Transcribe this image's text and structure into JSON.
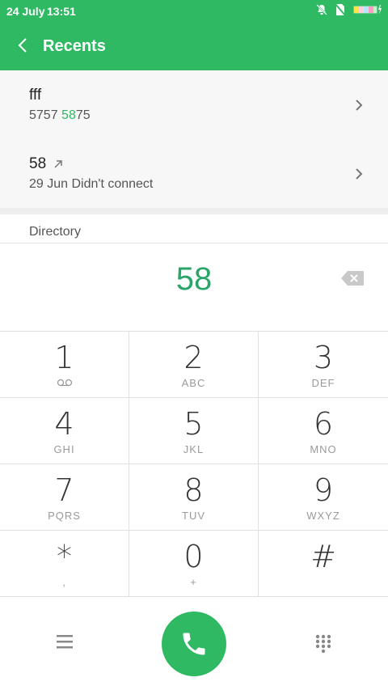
{
  "status_bar": {
    "date": "24 July",
    "time": "13:51"
  },
  "app_bar": {
    "title": "Recents"
  },
  "recents": [
    {
      "name": "fff",
      "number_prefix": "5757 ",
      "number_match": "58",
      "number_suffix": "75"
    },
    {
      "name": "58",
      "detail": "29 Jun Didn't connect"
    }
  ],
  "directory": {
    "label": "Directory"
  },
  "dialer": {
    "entered_number": "58"
  },
  "keypad": [
    {
      "digit": "1",
      "letters": ""
    },
    {
      "digit": "2",
      "letters": "ABC"
    },
    {
      "digit": "3",
      "letters": "DEF"
    },
    {
      "digit": "4",
      "letters": "GHI"
    },
    {
      "digit": "5",
      "letters": "JKL"
    },
    {
      "digit": "6",
      "letters": "MNO"
    },
    {
      "digit": "7",
      "letters": "PQRS"
    },
    {
      "digit": "8",
      "letters": "TUV"
    },
    {
      "digit": "9",
      "letters": "WXYZ"
    },
    {
      "digit": "*",
      "letters": ","
    },
    {
      "digit": "0",
      "letters": "+"
    },
    {
      "digit": "#",
      "letters": ""
    }
  ],
  "colors": {
    "accent": "#2fb963",
    "number": "#2aa56a"
  }
}
